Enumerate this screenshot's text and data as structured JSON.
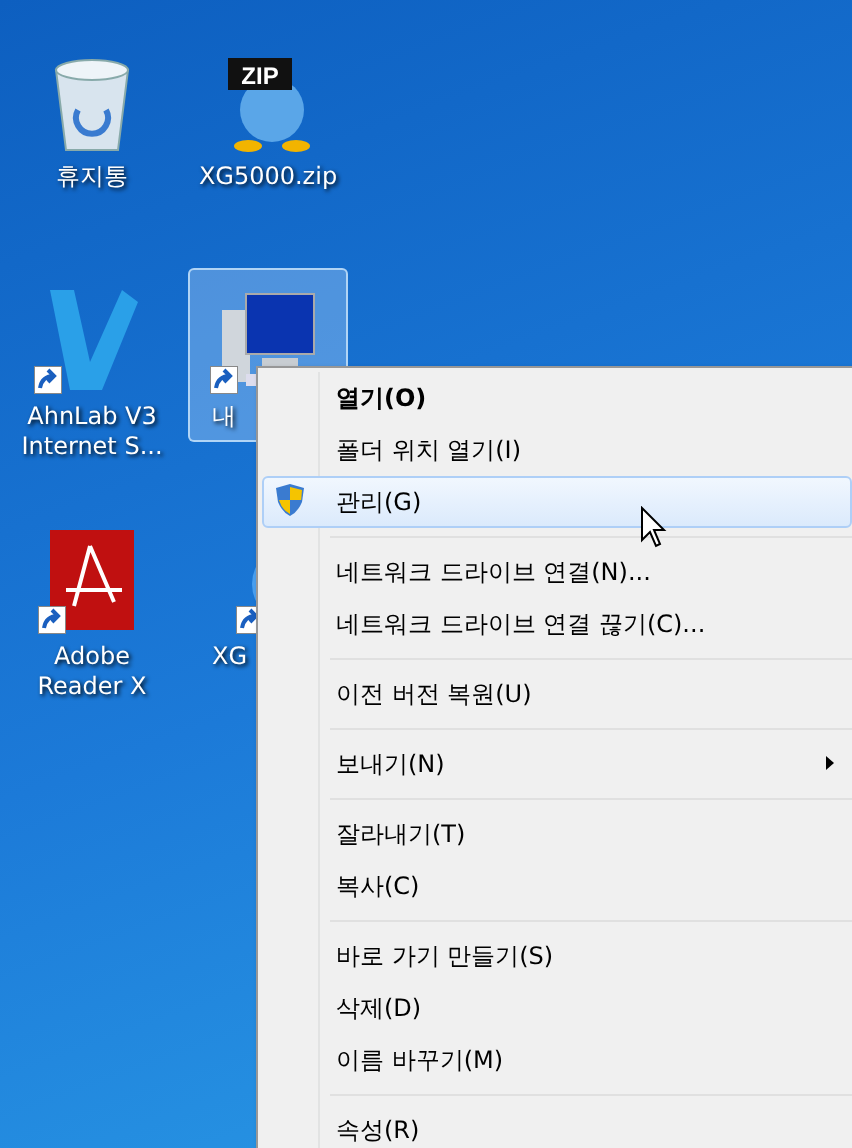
{
  "desktop": {
    "icons": [
      {
        "kind": "recycle-bin",
        "label": "휴지통",
        "shortcut": false,
        "selected": false
      },
      {
        "kind": "zip",
        "badge": "ZIP",
        "label": "XG5000.zip",
        "shortcut": false,
        "selected": false
      },
      {
        "kind": "antivirus",
        "label": "AhnLab V3 Internet S...",
        "shortcut": true,
        "selected": false
      },
      {
        "kind": "computer",
        "label": "내",
        "shortcut": true,
        "selected": true
      },
      {
        "kind": "pdf",
        "label": "Adobe Reader X",
        "shortcut": true,
        "selected": false
      },
      {
        "kind": "app",
        "label": "XG",
        "shortcut": true,
        "selected": false
      }
    ]
  },
  "context_menu": {
    "groups": [
      [
        {
          "kind": "default",
          "label": "열기(O)",
          "selected": false
        },
        {
          "kind": "plain",
          "label": "폴더 위치 열기(I)",
          "selected": false
        },
        {
          "kind": "admin",
          "label": "관리(G)",
          "selected": true
        }
      ],
      [
        {
          "kind": "plain",
          "label": "네트워크 드라이브 연결(N)...",
          "selected": false
        },
        {
          "kind": "plain",
          "label": "네트워크 드라이브 연결 끊기(C)...",
          "selected": false
        }
      ],
      [
        {
          "kind": "plain",
          "label": "이전 버전 복원(U)",
          "selected": false
        }
      ],
      [
        {
          "kind": "submenu",
          "label": "보내기(N)",
          "selected": false
        }
      ],
      [
        {
          "kind": "plain",
          "label": "잘라내기(T)",
          "selected": false
        },
        {
          "kind": "plain",
          "label": "복사(C)",
          "selected": false
        }
      ],
      [
        {
          "kind": "plain",
          "label": "바로 가기 만들기(S)",
          "selected": false
        },
        {
          "kind": "plain",
          "label": "삭제(D)",
          "selected": false
        },
        {
          "kind": "plain",
          "label": "이름 바꾸기(M)",
          "selected": false
        }
      ],
      [
        {
          "kind": "plain",
          "label": "속성(R)",
          "selected": false
        }
      ]
    ]
  }
}
